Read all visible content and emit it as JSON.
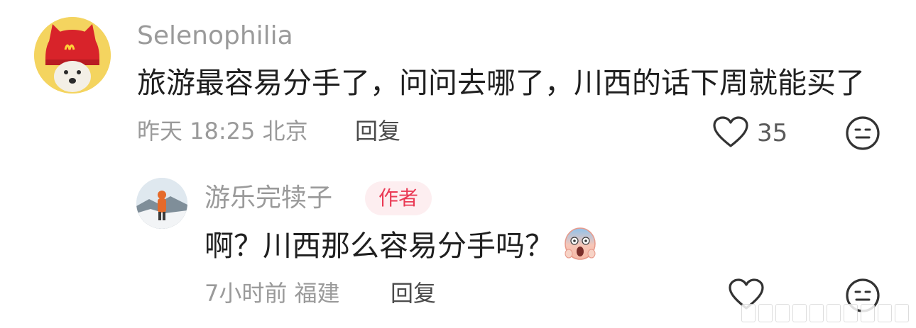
{
  "comment": {
    "username": "Selenophilia",
    "text": "旅游最容易分手了，问问去哪了，川西的话下周就能买了",
    "time": "昨天 18:25",
    "location": "北京",
    "reply_label": "回复",
    "like_count": "35"
  },
  "reply": {
    "username": "游乐完犊子",
    "badge": "作者",
    "text": "啊？川西那么容易分手吗？",
    "time": "7小时前",
    "location": "福建",
    "reply_label": "回复"
  },
  "icons": {
    "like": "heart-icon",
    "dislike": "neutral-face-icon",
    "emoji": "scream-emoji-icon"
  },
  "colors": {
    "text_primary": "#1f1f1f",
    "text_secondary": "#9a9a9a",
    "badge_text": "#ea3a55",
    "badge_bg": "#fdeef0"
  }
}
